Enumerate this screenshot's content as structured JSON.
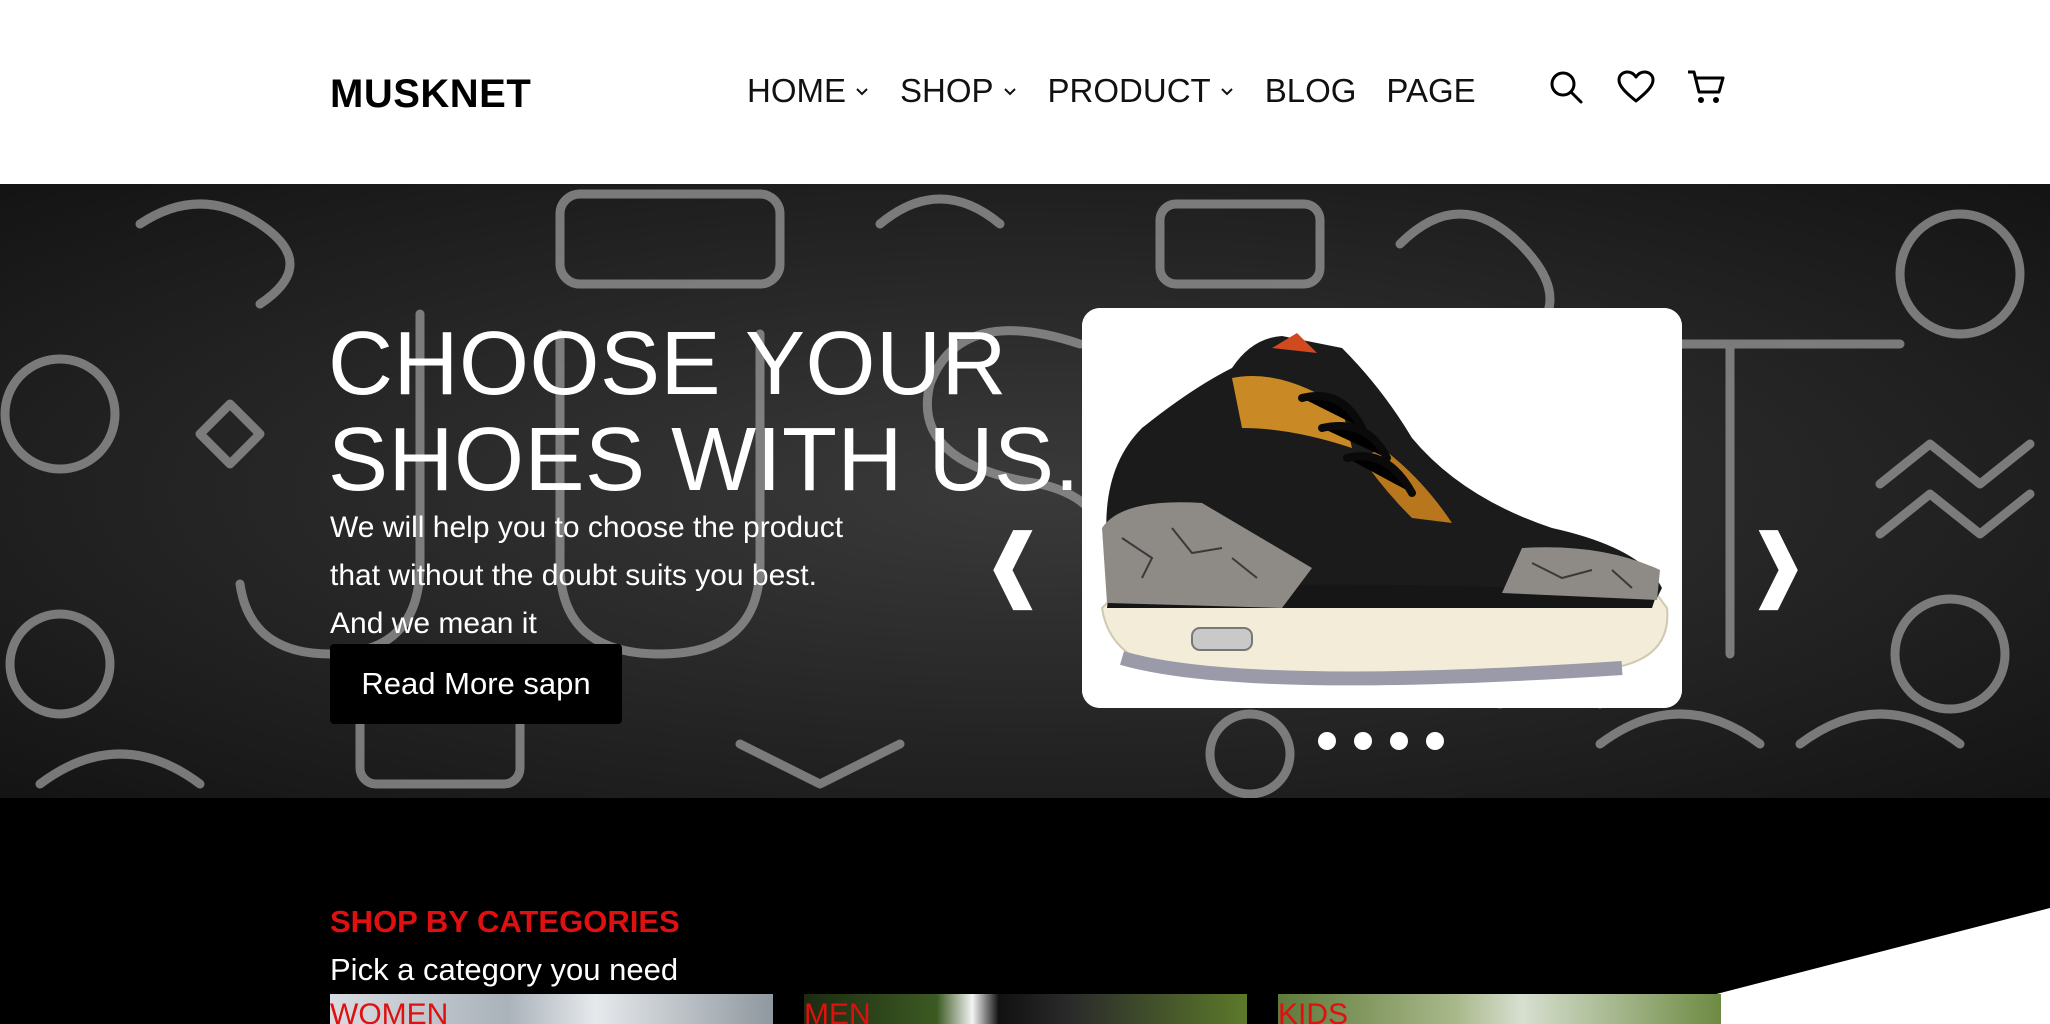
{
  "header": {
    "logo": "MUSKNET",
    "nav": [
      {
        "label": "HOME",
        "dropdown": true
      },
      {
        "label": "SHOP",
        "dropdown": true
      },
      {
        "label": "PRODUCT",
        "dropdown": true
      },
      {
        "label": "BLOG",
        "dropdown": false
      },
      {
        "label": "PAGE",
        "dropdown": false
      }
    ],
    "icons": [
      "search-icon",
      "heart-icon",
      "cart-icon"
    ]
  },
  "hero": {
    "title_line1": "CHOOSE YOUR",
    "title_line2": "SHOES WITH US.",
    "subtitle_line1": "We will help you to choose the product",
    "subtitle_line2": "that without the doubt suits you best.",
    "subtitle_line3": "And we mean it",
    "button_label": "Read More sapn",
    "prev_arrow": "❰",
    "next_arrow": "❱",
    "slide_count": 4
  },
  "categories": {
    "title": "SHOP BY CATEGORIES",
    "subtitle": "Pick a category you need",
    "items": [
      {
        "label": "WOMEN"
      },
      {
        "label": "MEN"
      },
      {
        "label": "KIDS"
      }
    ]
  },
  "colors": {
    "accent_red": "#e01010",
    "header_bg": "#ffffff",
    "section_bg": "#000000"
  }
}
